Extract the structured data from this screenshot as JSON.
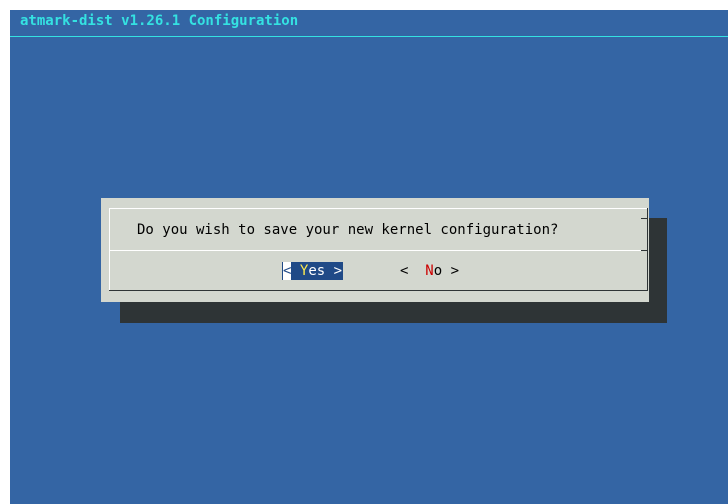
{
  "window": {
    "backtitle": "atmark-dist v1.26.1 Configuration"
  },
  "dialog": {
    "prompt": "Do you wish to save your new kernel configuration?",
    "buttons": {
      "yes": {
        "open": "<",
        "hotkey": "Y",
        "rest": "es",
        "close": ">"
      },
      "no": {
        "open": "< ",
        "hotkey": "N",
        "rest": "o",
        "close": " >"
      }
    }
  },
  "colors": {
    "background": "#3465a4",
    "backtitle": "#34e2e2",
    "dialog": "#d3d7cf",
    "shadow": "#2e3436",
    "selected_button": "#204a87",
    "yes_hotkey": "#fce94f",
    "no_hotkey": "#cc0000"
  }
}
